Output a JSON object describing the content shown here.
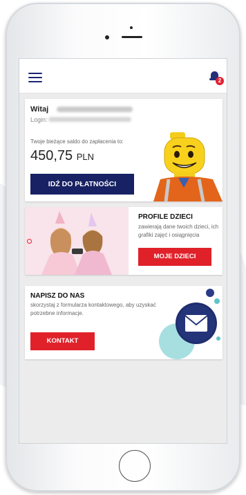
{
  "header": {
    "menu_icon": "hamburger-menu-icon",
    "notifications_icon": "bell-icon",
    "notification_count": "2"
  },
  "account": {
    "greeting": "Witaj",
    "login_label": "Login:",
    "balance_label": "Twoje bieżące saldo do zapłacenia to:",
    "balance_amount": "450,75",
    "balance_currency": "PLN",
    "pay_button": "IDŹ DO PŁATNOŚCI"
  },
  "profiles": {
    "title": "PROFILE DZIECI",
    "description": "zawierają dane twoich dzieci, ich grafiki zajęć i osiągnięcia",
    "button": "MOJE DZIECI"
  },
  "contact": {
    "title": "NAPISZ DO NAS",
    "description": "skorzystaj z formularza kontaktowego, aby uzyskać potrzebne informacje.",
    "button": "KONTAKT"
  },
  "colors": {
    "navy": "#172163",
    "red": "#e0212a",
    "screen_bg": "#ececec",
    "illustration_teal": "#5fc4c8"
  }
}
